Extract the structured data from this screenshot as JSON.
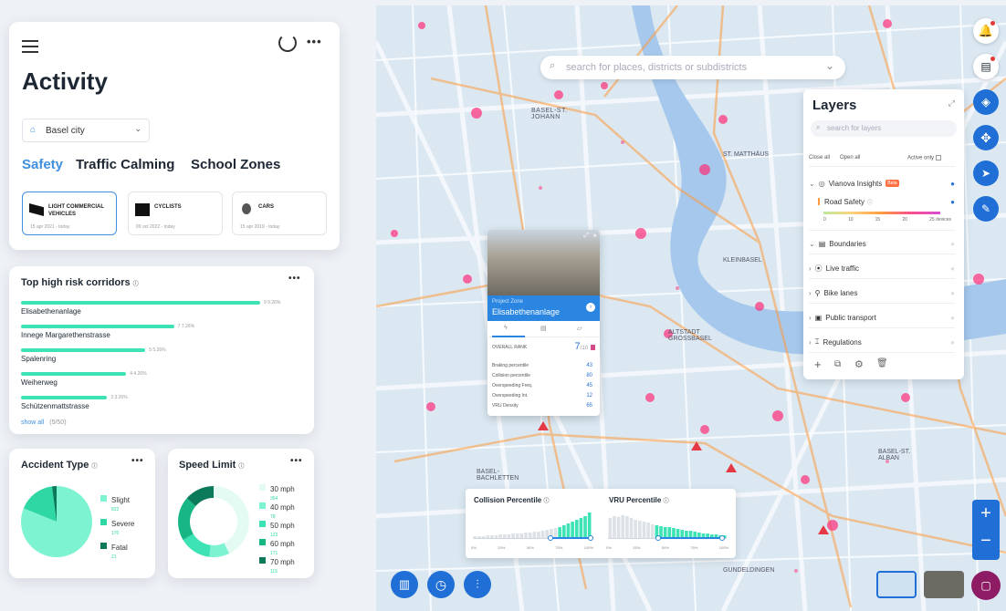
{
  "sidebar": {
    "title": "Activity",
    "city": "Basel city",
    "tabs": [
      "Safety",
      "Traffic Calming",
      "School Zones"
    ],
    "categories": [
      {
        "name_line1": "LIGHT COMMERCIAL",
        "name_line2": "VEHICLES",
        "date": "15 apr 2021 - today"
      },
      {
        "name_line1": "CYCLISTS",
        "name_line2": "",
        "date": "09 oct 2022 - today"
      },
      {
        "name_line1": "CARS",
        "name_line2": "",
        "date": "15 apr 2019 - today"
      }
    ]
  },
  "corridors": {
    "title": "Top high risk corridors",
    "items": [
      {
        "name": "Elisabethenanlage",
        "value": "9",
        "pct": "9.26%",
        "ratio": 1.0
      },
      {
        "name": "Innege Margarethenstrasse",
        "value": "7",
        "pct": "7.26%",
        "ratio": 0.64
      },
      {
        "name": "Spalenring",
        "value": "5",
        "pct": "5.26%",
        "ratio": 0.52
      },
      {
        "name": "Weiherweg",
        "value": "4",
        "pct": "4.26%",
        "ratio": 0.44
      },
      {
        "name": "Schützenmattstrasse",
        "value": "3",
        "pct": "3.26%",
        "ratio": 0.36
      }
    ],
    "show_all": "show all",
    "count": "(5/50)"
  },
  "accident": {
    "title": "Accident Type",
    "items": [
      {
        "label": "Slight",
        "value": "822",
        "color": "#7ef3d2"
      },
      {
        "label": "Severe",
        "value": "170",
        "color": "#2fd7a5"
      },
      {
        "label": "Fatal",
        "value": "21",
        "color": "#0b7a5b"
      }
    ]
  },
  "speed": {
    "title": "Speed Limit",
    "items": [
      {
        "label": "30 mph",
        "value": "364",
        "color": "#e4fbf4"
      },
      {
        "label": "40 mph",
        "value": "78",
        "color": "#7ef3d2"
      },
      {
        "label": "50 mph",
        "value": "123",
        "color": "#3de3b5"
      },
      {
        "label": "60 mph",
        "value": "171",
        "color": "#18b585"
      },
      {
        "label": "70 mph",
        "value": "115",
        "color": "#0b7a5b"
      }
    ]
  },
  "map": {
    "search_placeholder": "search for places, districts or subdistricts",
    "labels": [
      "BASEL-ST. JOHANN",
      "ST. MATTHÄUS",
      "KLEINBASEL",
      "ALTSTADT GROSSBASEL",
      "BASEL-ST. ALBAN",
      "BASEL-BACHLETTEN",
      "GUNDELDINGEN"
    ]
  },
  "layers": {
    "title": "Layers",
    "search_placeholder": "search for layers",
    "close_all": "Close all",
    "open_all": "Open all",
    "active_only": "Active only",
    "vianova": "Vianova Insights",
    "beta": "Beta",
    "road_safety": "Road Safety",
    "scale": [
      "0",
      "10",
      "15",
      "20",
      "25 devices"
    ],
    "groups": [
      "Boundaries",
      "Live traffic",
      "Bike lanes",
      "Public transport",
      "Regulations"
    ]
  },
  "popup": {
    "zone_label": "Project Zone",
    "zone_name": "Elisabethenanlage",
    "overall_label": "OVERALL RANK",
    "overall_value": "7",
    "overall_suffix": "/10",
    "metrics": [
      {
        "label": "Braking percentile",
        "value": "43"
      },
      {
        "label": "Collision percentile",
        "value": "80"
      },
      {
        "label": "Overspeeding Freq.",
        "value": "45"
      },
      {
        "label": "Overspeeding Int.",
        "value": "12"
      },
      {
        "label": "VRU Density",
        "value": "65"
      }
    ]
  },
  "histograms": {
    "collision": "Collision Percentile",
    "vru": "VRU Percentile",
    "ticks": [
      "0%",
      "25%",
      "50%",
      "75%",
      "100%"
    ]
  }
}
